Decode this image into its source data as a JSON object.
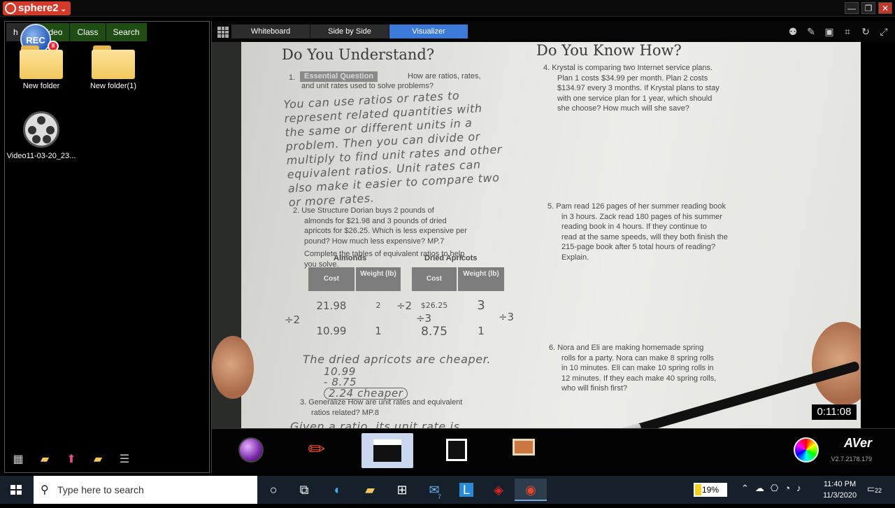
{
  "app": {
    "title": "sphere2",
    "dropdown": "⌄"
  },
  "window": {
    "minimize": "—",
    "restore": "❐",
    "close": "✕"
  },
  "left_panel": {
    "tabs": [
      {
        "label": "h"
      },
      {
        "label": "Video"
      },
      {
        "label": "Class"
      },
      {
        "label": "Search"
      }
    ],
    "rec": {
      "label": "REC",
      "badge": "II"
    },
    "items": [
      {
        "label": "New folder",
        "icon": "folder-icon"
      },
      {
        "label": "New folder(1)",
        "icon": "folder-icon"
      },
      {
        "label": "Video11-03-20_23...",
        "icon": "film-reel-icon"
      }
    ],
    "bottom_icons": [
      "layout-icon",
      "folder-open-icon",
      "upload-arrow-icon",
      "folder-add-icon",
      "list-icon"
    ]
  },
  "toolbar": {
    "modes": [
      {
        "label": "Whiteboard"
      },
      {
        "label": "Side by Side"
      },
      {
        "label": "Visualizer",
        "active": true
      }
    ],
    "right_icons": [
      "people-icon",
      "pen-icon",
      "window-icon",
      "crop-icon",
      "rotate-icon",
      "expand-icon"
    ]
  },
  "camera": {
    "timer": "0:11:08",
    "left_heading": "Do You Understand?",
    "right_heading": "Do You Know How?",
    "q1": {
      "num": "1.",
      "badge": "Essential Question",
      "text_a": "How are ratios, rates,",
      "text_b": "and unit rates used to solve problems?"
    },
    "q1_answer": [
      "You can use ratios or rates to",
      "represent related quantities with",
      "the same or different units in a",
      "problem. Then you can divide or",
      "multiply to find unit rates and other",
      "equivalent ratios. Unit rates can",
      "also make it easier to compare two",
      "or more rates."
    ],
    "q2": [
      "2. Use Structure Dorian buys 2 pounds of",
      "almonds for $21.98 and 3 pounds of dried",
      "apricots for $26.25. Which is less expensive per",
      "pound? How much less expensive?  MP.7",
      "Complete the tables of equivalent ratios to help",
      "you solve."
    ],
    "tables": {
      "almonds_title": "Almonds",
      "apricots_title": "Dried Apricots",
      "cost_header": "Cost",
      "weight_header": "Weight (lb)",
      "almonds_rows": [
        [
          "21.98",
          "2"
        ],
        [
          "10.99",
          "1"
        ]
      ],
      "apricots_rows": [
        [
          "$26.25",
          "3"
        ],
        [
          "8.75",
          "1"
        ]
      ],
      "divide_2": "÷2",
      "divide_3": "÷3"
    },
    "conclusion": "The dried apricots are cheaper.",
    "subtraction": [
      "10.99",
      "- 8.75",
      "2.24 cheaper"
    ],
    "q3": [
      "3. Generalize How are unit rates and equivalent",
      "ratios related?  MP.8"
    ],
    "q3_answer": "Given a ratio, its unit rate is",
    "q4": [
      "4. Krystal is comparing two Internet service plans.",
      "Plan 1 costs $34.99 per month. Plan 2 costs",
      "$134.97 every 3 months. If Krystal plans to stay",
      "with one service plan for 1 year, which should",
      "she choose? How much will she save?"
    ],
    "q5": [
      "5. Pam read 126 pages of her summer reading book",
      "in 3 hours. Zack read 180 pages of his summer",
      "reading book in 4 hours. If they continue to",
      "read at the same speeds, will they both finish the",
      "215-page book after 5 total hours of reading?",
      "Explain."
    ],
    "q6": [
      "6. Nora and Eli are making homemade spring",
      "rolls for a party. Nora can make 8 spring rolls",
      "in 10 minutes. Eli can make 10 spring rolls in",
      "12 minutes. If they each make 40 spring rolls,",
      "who will finish first?"
    ]
  },
  "dock": {
    "brand": "AVer",
    "version": "V2.7.2178.179",
    "items": [
      "sphere-icon",
      "pencil-ruler-icon",
      "clapperboard-icon",
      "camera-capture-icon",
      "presentation-icon"
    ]
  },
  "taskbar": {
    "search_placeholder": "Type here to search",
    "battery": "19%",
    "time": "11:40 PM",
    "date": "11/3/2020",
    "notifications": "22",
    "mail_badge": "7"
  }
}
